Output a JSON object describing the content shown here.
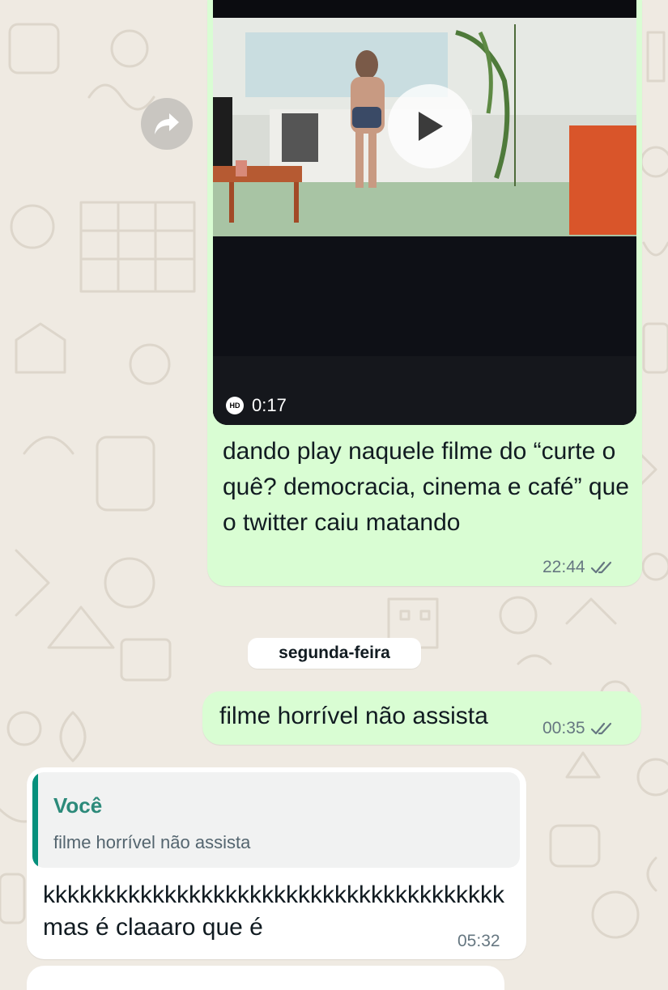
{
  "messages": {
    "video_message": {
      "duration": "0:17",
      "quality_badge": "HD",
      "caption": "dando play naquele filme do “curte o quê? democracia, cinema e café” que o twitter caiu matando",
      "time": "22:44",
      "status": "read"
    },
    "date_separator": "segunda-feira",
    "sent_message": {
      "text": "filme horrível não assista",
      "time": "00:35",
      "status": "read"
    },
    "received_message": {
      "quote": {
        "author": "Você",
        "text": "filme horrível não assista"
      },
      "text": "kkkkkkkkkkkkkkkkkkkkkkkkkkkkkkkkkkkkkk mas é claaaro que é",
      "time": "05:32"
    }
  },
  "icons": {
    "forward": "forward-arrow-icon",
    "play": "play-icon",
    "read_receipt": "double-check-icon"
  },
  "colors": {
    "wallpaper": "#efeae2",
    "outgoing_bubble": "#d9fdd3",
    "incoming_bubble": "#ffffff",
    "quote_accent": "#06907c",
    "timestamp": "#667781"
  }
}
